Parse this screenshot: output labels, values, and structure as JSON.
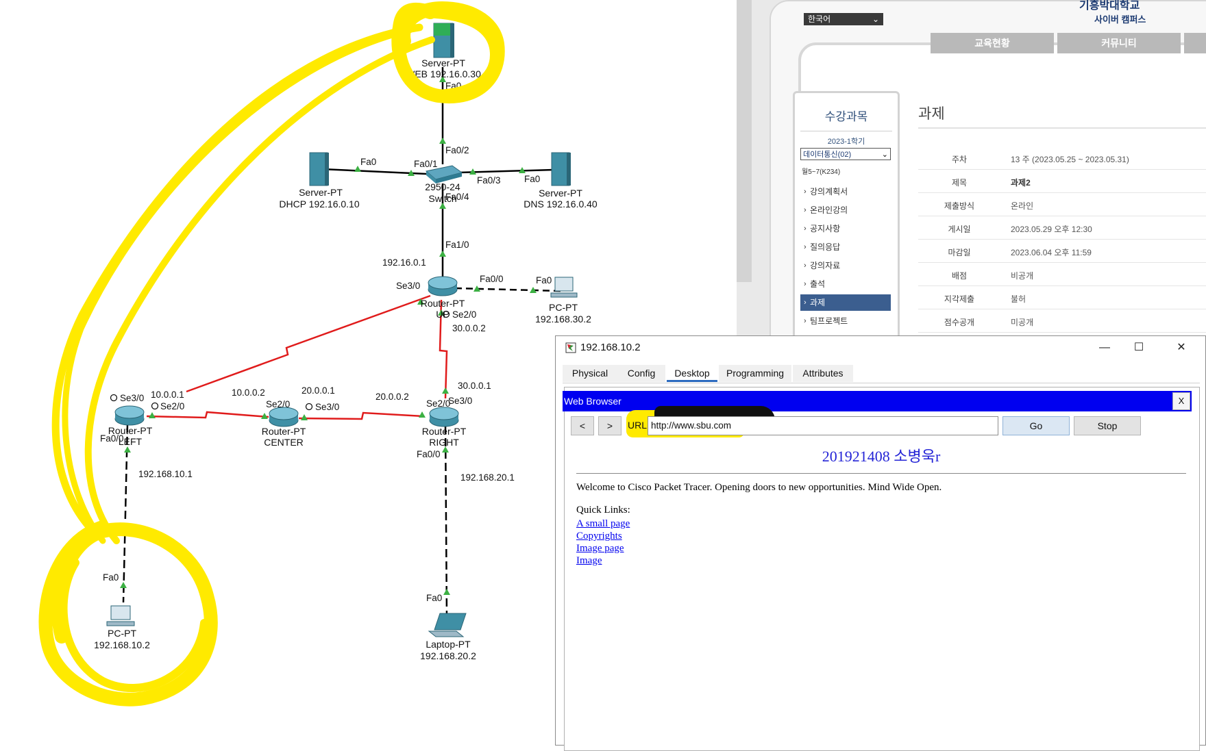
{
  "topology": {
    "devices": {
      "web_server": {
        "type": "Server-PT",
        "label": "WEB 192.16.0.30"
      },
      "dhcp_server": {
        "type": "Server-PT",
        "label": "DHCP 192.16.0.10"
      },
      "dns_server": {
        "type": "Server-PT",
        "label": "DNS 192.16.0.40"
      },
      "switch": {
        "type": "2950-24",
        "label": "Switch"
      },
      "router_up": {
        "type": "Router-PT",
        "label": "UP"
      },
      "router_left": {
        "type": "Router-PT",
        "label": "LEFT"
      },
      "router_center": {
        "type": "Router-PT",
        "label": "CENTER"
      },
      "router_right": {
        "type": "Router-PT",
        "label": "RIGHT"
      },
      "pc_up": {
        "type": "PC-PT",
        "label": "192.168.30.2"
      },
      "pc_left": {
        "type": "PC-PT",
        "label": "192.168.10.2"
      },
      "laptop": {
        "type": "Laptop-PT",
        "label": "192.168.20.2"
      }
    },
    "ports": {
      "web_fa0": "Fa0",
      "sw_fa02": "Fa0/2",
      "sw_fa01": "Fa0/1",
      "dhcp_fa0": "Fa0",
      "sw_fa03": "Fa0/3",
      "dns_fa0": "Fa0",
      "sw_fa04": "Fa0/4",
      "up_fa10": "Fa1/0",
      "up_fa00": "Fa0/0",
      "pcup_fa0": "Fa0",
      "up_se30": "Se3/0",
      "up_se20": "Se2/0",
      "left_se30": "Se3/0",
      "left_se20": "Se2/0",
      "left_fa00": "Fa0/0",
      "center_se20": "Se2/0",
      "center_se30": "Se3/0",
      "right_se20": "Se2/0",
      "right_se30": "Se3/0",
      "right_fa00": "Fa0/0",
      "pcleft_fa0": "Fa0",
      "laptop_fa0": "Fa0"
    },
    "ips": {
      "up_lan": "192.16.0.1",
      "up_right": "30.0.0.2",
      "left_up": "10.0.0.1",
      "center_left": "10.0.0.2",
      "center_right": "20.0.0.1",
      "right_center": "20.0.0.2",
      "right_up": "30.0.0.1",
      "left_lan": "192.168.10.1",
      "right_lan": "192.168.20.1"
    }
  },
  "lms": {
    "language": "한국어",
    "university": "기흥박대학교",
    "campus": "사이버 캠퍼스",
    "nav": [
      "교육현황",
      "커뮤니티"
    ],
    "sidebar": {
      "title": "수강과목",
      "semester": "2023-1학기",
      "course": "데이터통신(02)",
      "room": "월5~7(K234)",
      "items": [
        "강의계획서",
        "온라인강의",
        "공지사항",
        "질의응답",
        "강의자료",
        "출석",
        "과제",
        "팀프로젝트"
      ],
      "active_index": 6
    },
    "page_title": "과제",
    "rows": [
      {
        "k": "주차",
        "v": "13 주 (2023.05.25 ~ 2023.05.31)"
      },
      {
        "k": "제목",
        "v": "과제2"
      },
      {
        "k": "제출방식",
        "v": "온라인"
      },
      {
        "k": "게시일",
        "v": "2023.05.29 오후 12:30"
      },
      {
        "k": "마감일",
        "v": "2023.06.04 오후 11:59"
      },
      {
        "k": "배점",
        "v": "비공개"
      },
      {
        "k": "지각제출",
        "v": "불허"
      },
      {
        "k": "점수공개",
        "v": "미공개"
      }
    ]
  },
  "pt_window": {
    "title": "192.168.10.2",
    "controls": {
      "minimize": "—",
      "maximize": "☐",
      "close": "✕"
    },
    "tabs": [
      "Physical",
      "Config",
      "Desktop",
      "Programming",
      "Attributes"
    ],
    "active_tab": "Desktop",
    "browser": {
      "bar_title": "Web Browser",
      "close": "X",
      "back": "<",
      "forward": ">",
      "url_label": "URL",
      "url": "http://www.sbu.com",
      "go": "Go",
      "stop": "Stop",
      "heading": "201921408 소병욱r",
      "welcome": "Welcome to Cisco Packet Tracer. Opening doors to new opportunities. Mind Wide Open.",
      "quick_links_label": "Quick Links:",
      "links": [
        "A small page",
        "Copyrights",
        "Image page",
        "Image"
      ]
    }
  },
  "colors": {
    "serial_link": "#e01b1b",
    "highlight": "#ffea00",
    "browser_bar": "#0000f0",
    "link": "#0000ee",
    "heading": "#2323d6"
  }
}
